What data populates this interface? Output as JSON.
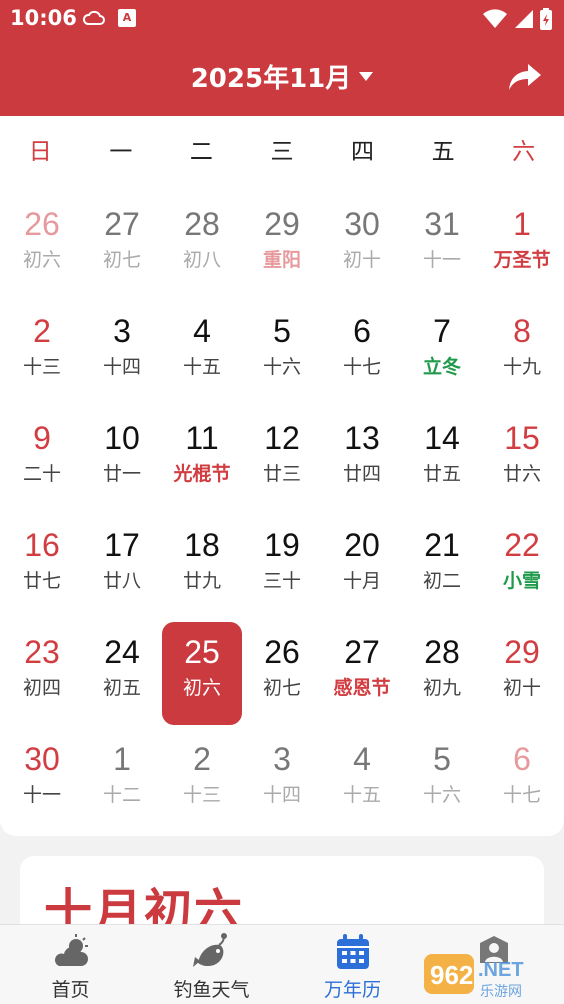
{
  "status_bar": {
    "time": "10:06",
    "a_badge": "A"
  },
  "header": {
    "month_title": "2025年11月",
    "share_icon": "share-icon"
  },
  "weekdays": [
    "日",
    "一",
    "二",
    "三",
    "四",
    "五",
    "六"
  ],
  "calendar": {
    "weeks": [
      [
        {
          "day": "26",
          "sub": "初六",
          "other": true
        },
        {
          "day": "27",
          "sub": "初七",
          "other": true
        },
        {
          "day": "28",
          "sub": "初八",
          "other": true
        },
        {
          "day": "29",
          "sub": "重阳",
          "other": true,
          "kind": "festival"
        },
        {
          "day": "30",
          "sub": "初十",
          "other": true
        },
        {
          "day": "31",
          "sub": "十一",
          "other": true
        },
        {
          "day": "1",
          "sub": "万圣节",
          "kind": "festival"
        }
      ],
      [
        {
          "day": "2",
          "sub": "十三"
        },
        {
          "day": "3",
          "sub": "十四"
        },
        {
          "day": "4",
          "sub": "十五"
        },
        {
          "day": "5",
          "sub": "十六"
        },
        {
          "day": "6",
          "sub": "十七"
        },
        {
          "day": "7",
          "sub": "立冬",
          "kind": "term"
        },
        {
          "day": "8",
          "sub": "十九"
        }
      ],
      [
        {
          "day": "9",
          "sub": "二十"
        },
        {
          "day": "10",
          "sub": "廿一"
        },
        {
          "day": "11",
          "sub": "光棍节",
          "kind": "festival"
        },
        {
          "day": "12",
          "sub": "廿三"
        },
        {
          "day": "13",
          "sub": "廿四"
        },
        {
          "day": "14",
          "sub": "廿五"
        },
        {
          "day": "15",
          "sub": "廿六"
        }
      ],
      [
        {
          "day": "16",
          "sub": "廿七"
        },
        {
          "day": "17",
          "sub": "廿八"
        },
        {
          "day": "18",
          "sub": "廿九"
        },
        {
          "day": "19",
          "sub": "三十"
        },
        {
          "day": "20",
          "sub": "十月"
        },
        {
          "day": "21",
          "sub": "初二"
        },
        {
          "day": "22",
          "sub": "小雪",
          "kind": "term"
        }
      ],
      [
        {
          "day": "23",
          "sub": "初四"
        },
        {
          "day": "24",
          "sub": "初五"
        },
        {
          "day": "25",
          "sub": "初六",
          "selected": true
        },
        {
          "day": "26",
          "sub": "初七"
        },
        {
          "day": "27",
          "sub": "感恩节",
          "kind": "festival"
        },
        {
          "day": "28",
          "sub": "初九"
        },
        {
          "day": "29",
          "sub": "初十"
        }
      ],
      [
        {
          "day": "30",
          "sub": "十一"
        },
        {
          "day": "1",
          "sub": "十二",
          "other": true
        },
        {
          "day": "2",
          "sub": "十三",
          "other": true
        },
        {
          "day": "3",
          "sub": "十四",
          "other": true
        },
        {
          "day": "4",
          "sub": "十五",
          "other": true
        },
        {
          "day": "5",
          "sub": "十六",
          "other": true
        },
        {
          "day": "6",
          "sub": "十七",
          "other": true
        }
      ]
    ]
  },
  "lunar_card": {
    "date": "十月初六"
  },
  "bottom_nav": {
    "items": [
      {
        "label": "首页",
        "icon": "weather-cloud-sun-icon"
      },
      {
        "label": "钓鱼天气",
        "icon": "fish-icon"
      },
      {
        "label": "万年历",
        "icon": "calendar-icon",
        "active": true
      },
      {
        "label": "",
        "icon": "profile-icon"
      }
    ]
  },
  "colors": {
    "brand_red": "#cb3a3f",
    "festival_red": "#d23d42",
    "term_green": "#1f9a4b",
    "active_blue": "#2c6fd8"
  }
}
